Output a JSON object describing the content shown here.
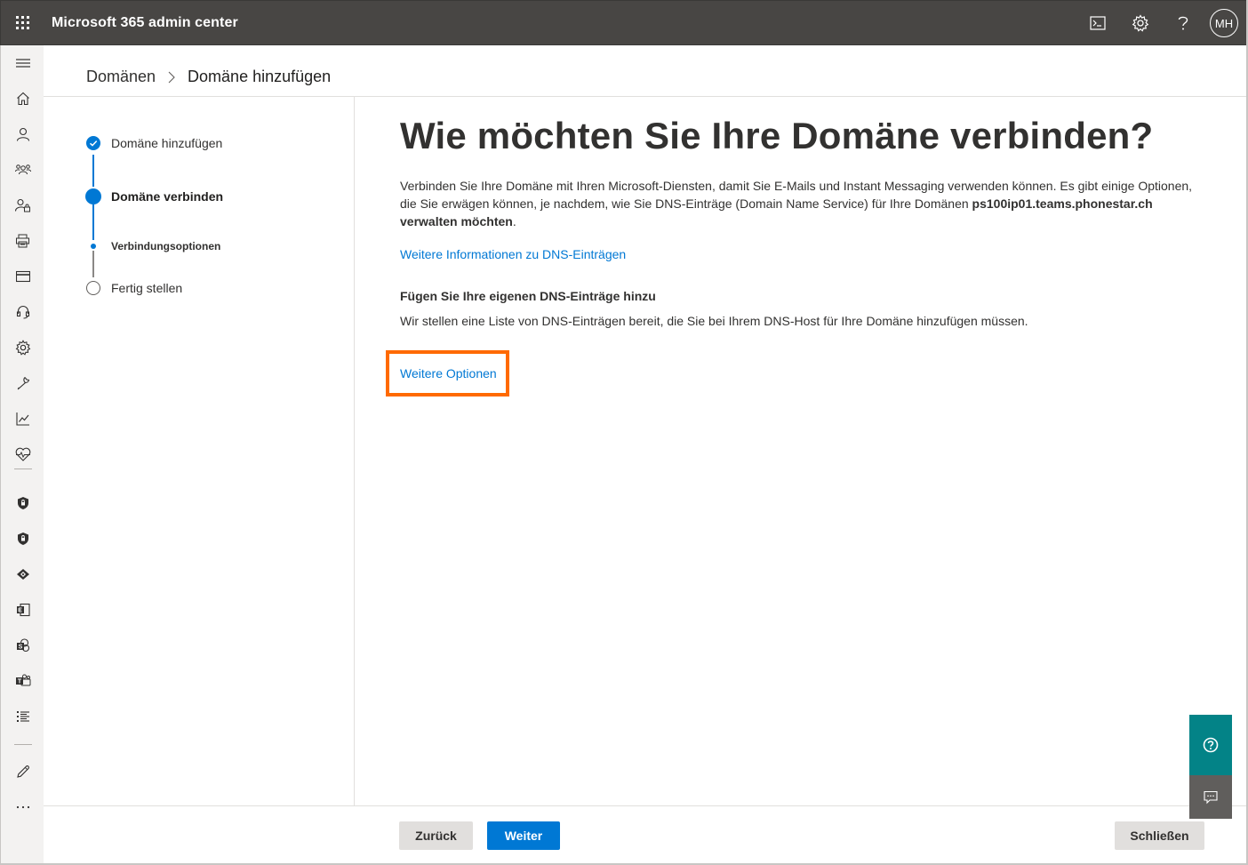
{
  "app": {
    "title": "Microsoft 365 admin center",
    "user_initials": "MH"
  },
  "breadcrumb": {
    "parent": "Domänen",
    "current": "Domäne hinzufügen"
  },
  "stepper": {
    "steps": [
      {
        "label": "Domäne hinzufügen",
        "state": "done"
      },
      {
        "label": "Domäne verbinden",
        "state": "current"
      },
      {
        "label": "Verbindungsoptionen",
        "state": "current-substep"
      },
      {
        "label": "Fertig stellen",
        "state": "pending"
      }
    ]
  },
  "main": {
    "title": "Wie möchten Sie Ihre Domäne verbinden?",
    "intro_prefix": "Verbinden Sie Ihre Domäne mit Ihren Microsoft-Diensten, damit Sie E-Mails und Instant Messaging verwenden können. Es gibt einige Optionen, die Sie erwägen können, je nachdem, wie Sie DNS-Einträge (Domain Name Service) für Ihre Domänen ",
    "intro_bold": "ps100ip01.teams.phonestar.ch verwalten möchten",
    "intro_suffix": ".",
    "dns_info_link": "Weitere Informationen zu DNS-Einträgen",
    "option_heading": "Fügen Sie Ihre eigenen DNS-Einträge hinzu",
    "option_text": "Wir stellen eine Liste von DNS-Einträgen bereit, die Sie bei Ihrem DNS-Host für Ihre Domäne hinzufügen müssen.",
    "more_options_link": "Weitere Optionen"
  },
  "footer": {
    "back_label": "Zurück",
    "next_label": "Weiter",
    "close_label": "Schließen"
  },
  "colors": {
    "accent": "#0078d4",
    "topbar": "#484644",
    "highlight": "#ff6a00",
    "help": "#038387"
  },
  "icons": {
    "top": [
      "terminal-icon",
      "settings-icon",
      "help-icon"
    ],
    "nav": [
      "hamburger-icon",
      "home-icon",
      "user-icon",
      "groups-icon",
      "roles-icon",
      "resources-icon",
      "billing-icon",
      "support-icon",
      "settings-icon",
      "setup-icon",
      "reports-icon",
      "health-icon",
      "security-icon",
      "compliance-icon",
      "endpoint-manager-icon",
      "exchange-icon",
      "sharepoint-icon",
      "teams-icon",
      "all-admin-centers-icon",
      "customize-icon",
      "more-icon"
    ]
  }
}
